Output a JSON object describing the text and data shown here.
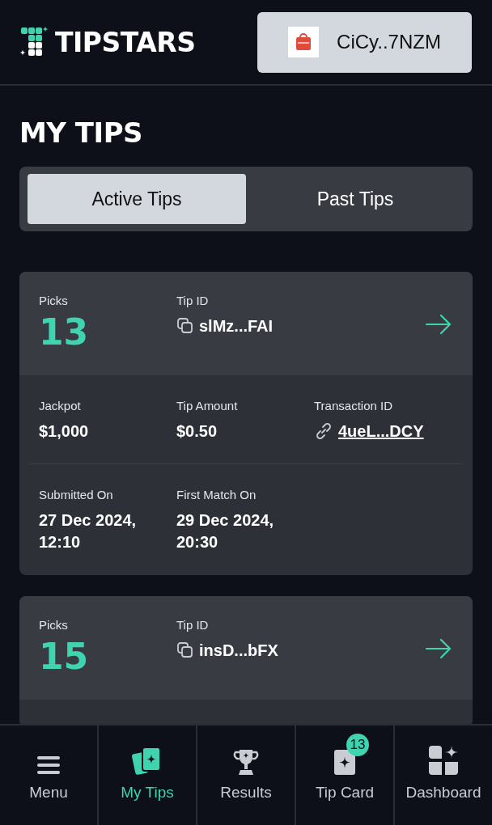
{
  "header": {
    "logo_text": "TIPSTARS",
    "wallet_label": "CiCy..7NZM"
  },
  "page_title": "MY TIPS",
  "tabs": [
    {
      "label": "Active Tips",
      "selected": true
    },
    {
      "label": "Past Tips",
      "selected": false
    }
  ],
  "tips": [
    {
      "picks_label": "Picks",
      "picks": "13",
      "tip_id_label": "Tip ID",
      "tip_id": "slMz...FAI",
      "details": [
        {
          "label": "Jackpot",
          "value": "$1,000",
          "kind": "plain"
        },
        {
          "label": "Tip Amount",
          "value": "$0.50",
          "kind": "plain"
        },
        {
          "label": "Transaction ID",
          "value": "4ueL...DCY",
          "kind": "link"
        }
      ],
      "dates": [
        {
          "label": "Submitted On",
          "value": "27 Dec 2024, 12:10"
        },
        {
          "label": "First Match On",
          "value": "29 Dec 2024, 20:30"
        }
      ]
    },
    {
      "picks_label": "Picks",
      "picks": "15",
      "tip_id_label": "Tip ID",
      "tip_id": "insD...bFX"
    }
  ],
  "nav": [
    {
      "label": "Menu",
      "selected": false
    },
    {
      "label": "My Tips",
      "selected": true
    },
    {
      "label": "Results",
      "selected": false
    },
    {
      "label": "Tip Card",
      "selected": false,
      "badge": "13"
    },
    {
      "label": "Dashboard",
      "selected": false
    }
  ]
}
